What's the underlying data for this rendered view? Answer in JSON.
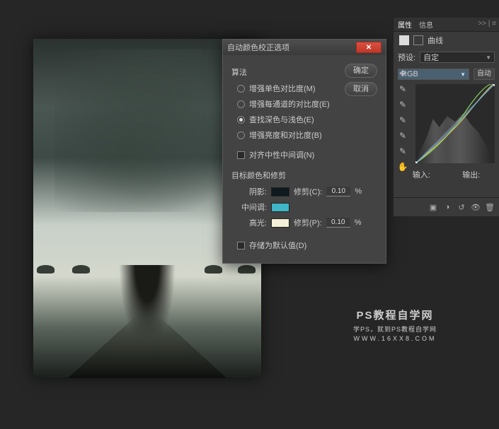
{
  "dialog": {
    "title": "自动颜色校正选项",
    "section_algorithm": "算法",
    "algo": {
      "opt1": "增强单色对比度(M)",
      "opt2": "增强每通道的对比度(E)",
      "opt3": "查找深色与浅色(E)",
      "opt4": "增强亮度和对比度(B)"
    },
    "snap_neutral": "对齐中性中间调(N)",
    "section_target": "目标颜色和修剪",
    "shadows_label": "阴影:",
    "midtones_label": "中间调:",
    "highlights_label": "高光:",
    "clip_c_label": "修剪(C):",
    "clip_p_label": "修剪(P):",
    "clip_c_value": "0.10",
    "clip_p_value": "0.10",
    "pct": "%",
    "save_default": "存储为默认值(D)",
    "ok": "确定",
    "cancel": "取消",
    "colors": {
      "shadow": "#0f1a1e",
      "mid": "#3fb7c8",
      "hi": "#f4efd6"
    }
  },
  "panel": {
    "tab_properties": "属性",
    "tab_info": "信息",
    "sub_label": "曲线",
    "preset_label": "预设:",
    "preset_value": "自定",
    "channel_value": "RGB",
    "auto": "自动",
    "input": "输入:",
    "output": "输出:",
    "collapse": ">> | ≡"
  },
  "watermark": {
    "l1": "PS教程自学网",
    "l2": "学PS，就到PS教程自学网",
    "l3": "WWW.16XX8.COM"
  }
}
